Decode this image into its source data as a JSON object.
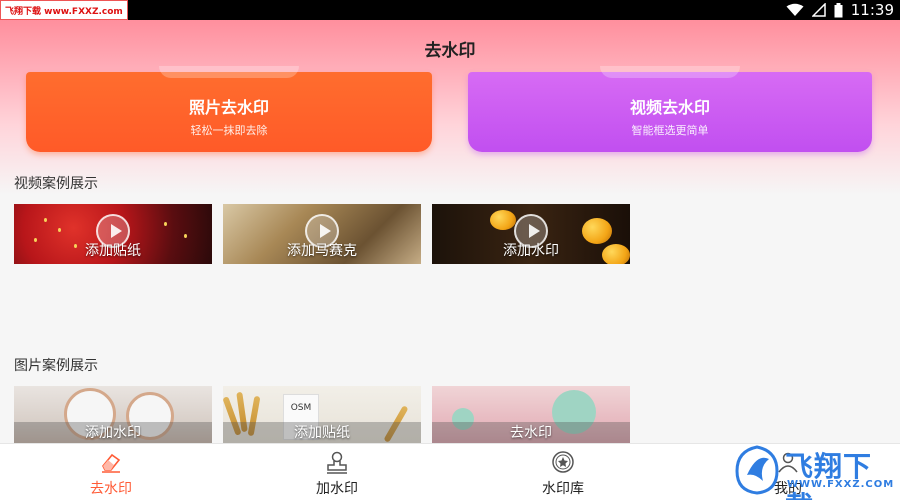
{
  "status_bar": {
    "badge_text": "飞翔下载 www.FXXZ.com",
    "time": "11:39"
  },
  "header": {
    "title": "去水印"
  },
  "feature_cards": {
    "photo": {
      "title": "照片去水印",
      "subtitle": "轻松一抹即去除"
    },
    "video": {
      "title": "视频去水印",
      "subtitle": "智能框选更简单"
    }
  },
  "video_section": {
    "title": "视频案例展示",
    "items": [
      {
        "label": "添加贴纸"
      },
      {
        "label": "添加马赛克"
      },
      {
        "label": "添加水印"
      }
    ]
  },
  "image_section": {
    "title": "图片案例展示",
    "items": [
      {
        "label": "添加水印"
      },
      {
        "label": "添加贴纸"
      },
      {
        "label": "去水印"
      }
    ]
  },
  "bottom_nav": {
    "items": [
      {
        "label": "去水印",
        "icon": "eraser-icon",
        "active": true
      },
      {
        "label": "加水印",
        "icon": "stamp-icon",
        "active": false
      },
      {
        "label": "水印库",
        "icon": "badge-library-icon",
        "active": false
      },
      {
        "label": "我的",
        "icon": "profile-icon",
        "active": false
      }
    ]
  },
  "corner_watermark": {
    "brand": "飞翔下载",
    "url": "WWW.FXXZ.COM"
  },
  "colors": {
    "accent": "#ff5b36",
    "photo_card": "#ff5f2b",
    "video_card": "#c85cf2",
    "header_gradient_top": "#ff8f9d"
  }
}
